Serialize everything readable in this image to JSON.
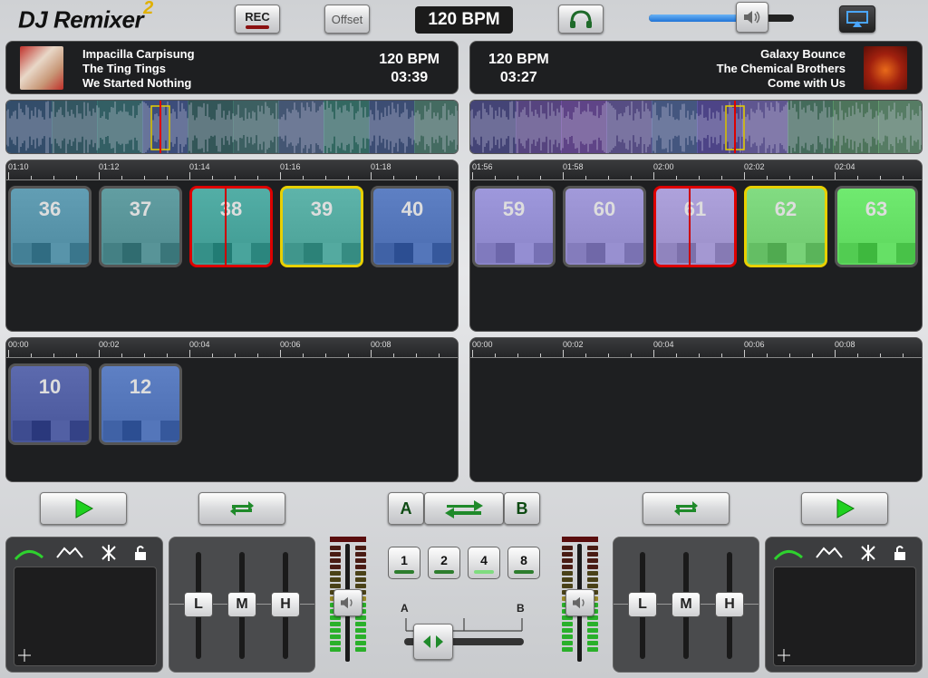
{
  "app": {
    "title": "DJ Remixer",
    "version_mark": "2"
  },
  "toolbar": {
    "rec_label": "REC",
    "offset_label": "Offset",
    "bpm": "120 BPM",
    "volume_fraction": 0.75
  },
  "deck_left": {
    "artist_line1": "Impacilla Carpisung",
    "artist_line2": "The Ting Tings",
    "artist_line3": "We Started Nothing",
    "bpm": "120 BPM",
    "time": "03:39",
    "timeline_top": [
      "01:10",
      "01:12",
      "01:14",
      "01:16",
      "01:18"
    ],
    "timeline_bottom": [
      "00:00",
      "00:02",
      "00:04",
      "00:06",
      "00:08"
    ],
    "pads_top": [
      {
        "n": "36",
        "color": "#4e8aa0",
        "state": "normal"
      },
      {
        "n": "37",
        "color": "#4e8a8e",
        "state": "normal"
      },
      {
        "n": "38",
        "color": "#3f9a92",
        "state": "playing"
      },
      {
        "n": "39",
        "color": "#4aa096",
        "state": "queued"
      },
      {
        "n": "40",
        "color": "#4a6cb0",
        "state": "normal"
      }
    ],
    "pads_bottom": [
      {
        "n": "10",
        "color": "#48569a",
        "state": "normal"
      },
      {
        "n": "12",
        "color": "#4a6cb0",
        "state": "normal"
      }
    ],
    "eq": [
      "L",
      "M",
      "H"
    ]
  },
  "deck_right": {
    "artist_line1": "Galaxy Bounce",
    "artist_line2": "The Chemical Brothers",
    "artist_line3": "Come with Us",
    "bpm": "120 BPM",
    "time": "03:27",
    "timeline_top": [
      "01:56",
      "01:58",
      "02:00",
      "02:02",
      "02:04"
    ],
    "timeline_bottom": [
      "00:00",
      "00:02",
      "00:04",
      "00:06",
      "00:08"
    ],
    "pads_top": [
      {
        "n": "59",
        "color": "#8a84c8",
        "state": "normal"
      },
      {
        "n": "60",
        "color": "#8e86c6",
        "state": "normal"
      },
      {
        "n": "61",
        "color": "#9a8ec8",
        "state": "playing"
      },
      {
        "n": "62",
        "color": "#6ec86e",
        "state": "queued"
      },
      {
        "n": "63",
        "color": "#5cd65c",
        "state": "normal"
      }
    ],
    "eq": [
      "L",
      "M",
      "H"
    ]
  },
  "center": {
    "a_label": "A",
    "b_label": "B",
    "beat_buttons": [
      "1",
      "2",
      "4",
      "8"
    ],
    "active_beat": "4",
    "crossfader_a": "A",
    "crossfader_b": "B"
  },
  "colors": {
    "play_green": "#1fd11f",
    "loop_green": "#1f8a2a",
    "accent_yellow": "#e0b000"
  }
}
